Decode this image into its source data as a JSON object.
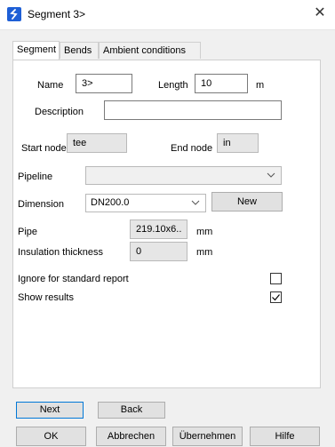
{
  "window": {
    "title": "Segment 3>",
    "close_glyph": "✕",
    "icon": "app-logo-icon"
  },
  "tabs": [
    {
      "label": "Segment",
      "active": true
    },
    {
      "label": "Bends",
      "active": false
    },
    {
      "label": "Ambient conditions",
      "active": false
    }
  ],
  "segment": {
    "name_label": "Name",
    "name_value": "3>",
    "length_label": "Length",
    "length_value": "10",
    "length_unit": "m",
    "description_label": "Description",
    "description_value": "",
    "start_node_label": "Start node",
    "start_node_value": "tee",
    "end_node_label": "End node",
    "end_node_value": "in",
    "pipeline_label": "Pipeline",
    "pipeline_value": "",
    "dimension_label": "Dimension",
    "dimension_value": "DN200.0",
    "new_button": "New",
    "pipe_label": "Pipe",
    "pipe_value": "219.10x6..",
    "pipe_unit": "mm",
    "insulation_label": "Insulation thickness",
    "insulation_value": "0",
    "insulation_unit": "mm",
    "ignore_label": "Ignore for standard report",
    "ignore_checked": false,
    "show_results_label": "Show results",
    "show_results_checked": true
  },
  "nav": {
    "next": "Next",
    "back": "Back"
  },
  "footer": {
    "ok": "OK",
    "cancel": "Abbrechen",
    "apply": "Übernehmen",
    "help": "Hilfe"
  },
  "colors": {
    "accent": "#1e5fd6",
    "default_button_border": "#0078d7",
    "background": "#f0f0f0"
  }
}
